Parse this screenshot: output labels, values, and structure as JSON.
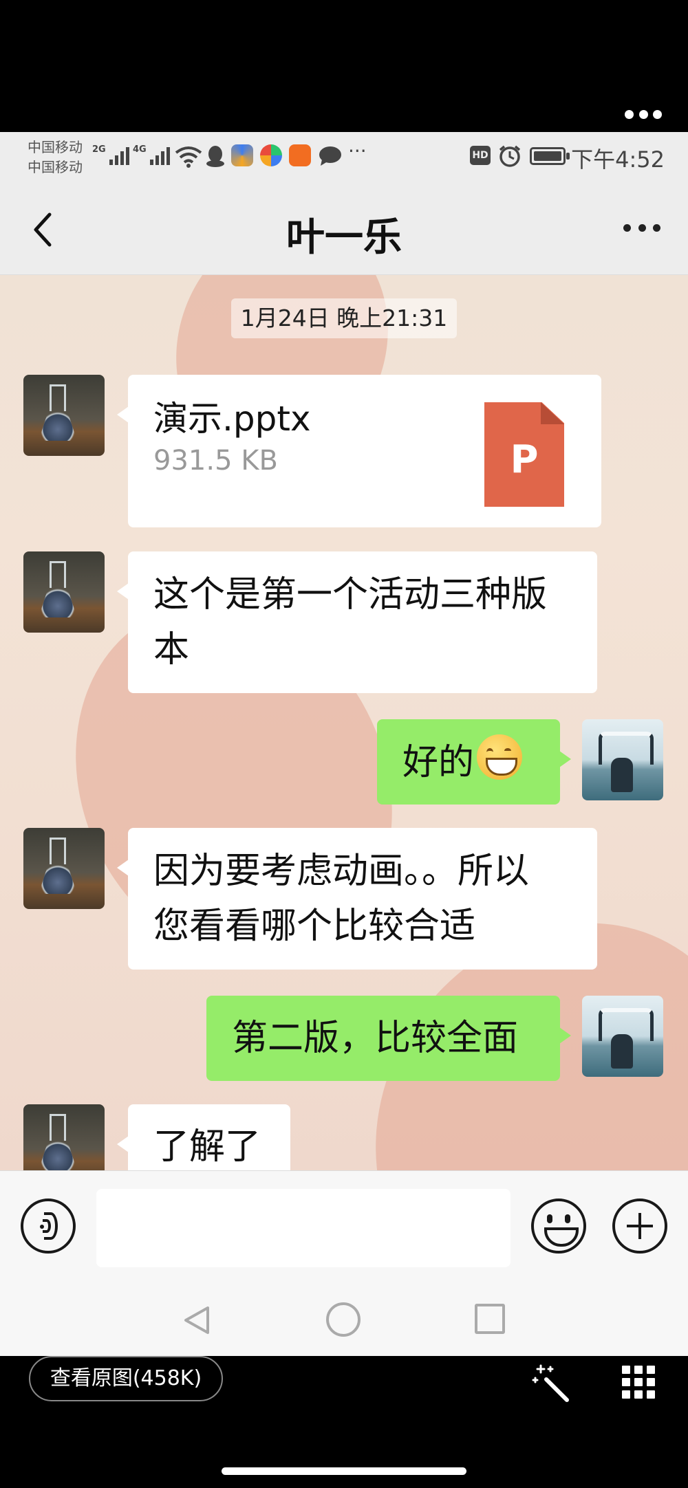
{
  "status_bar": {
    "carrier_1": "中国移动",
    "carrier_2": "中国移动",
    "sig1_label": "2G",
    "sig2_label": "4G",
    "time": "下午4:52",
    "hd_badge": "HD"
  },
  "header": {
    "title": "叶一乐",
    "back_icon": "chevron-left",
    "menu_icon": "more-dots"
  },
  "chat": {
    "timestamp": "1月24日 晚上21:31",
    "messages": [
      {
        "side": "in",
        "type": "file",
        "file_name": "演示.pptx",
        "file_size": "931.5 KB",
        "file_icon_letter": "P"
      },
      {
        "side": "in",
        "type": "text",
        "lines": [
          "这个是第一个活动三种版",
          "本"
        ]
      },
      {
        "side": "out",
        "type": "text",
        "text": "好的",
        "emoji": "grinning-face"
      },
      {
        "side": "in",
        "type": "text",
        "lines": [
          "因为要考虑动画。。所以",
          "您看看哪个比较合适"
        ]
      },
      {
        "side": "out",
        "type": "text",
        "text": "第二版，比较全面"
      },
      {
        "side": "in",
        "type": "text",
        "text": "了解了"
      }
    ]
  },
  "input_bar": {
    "voice_icon": "voice-icon",
    "emoji_icon": "emoji-icon",
    "plus_icon": "plus-icon",
    "placeholder": ""
  },
  "viewer": {
    "view_original": "查看原图(458K)"
  },
  "colors": {
    "bubble_out": "#95ec69",
    "bubble_in": "#ffffff",
    "file_icon": "#e0664a"
  }
}
